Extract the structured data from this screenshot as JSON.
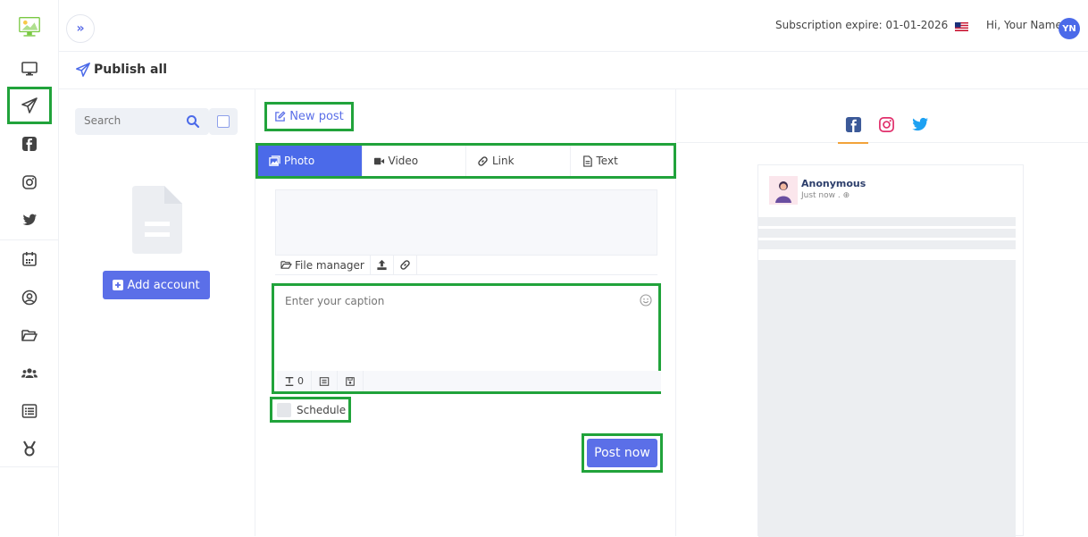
{
  "topbar": {
    "expand_icon": "double-chevron-right-icon",
    "subscription": "Subscription expire: 01-01-2026",
    "greeting": "Hi, Your Name",
    "avatar_initials": "YN"
  },
  "sidebar": {
    "items": [
      {
        "name": "dashboard-icon"
      },
      {
        "name": "paper-plane-icon",
        "active": true
      },
      {
        "name": "facebook-icon"
      },
      {
        "name": "instagram-icon"
      },
      {
        "name": "twitter-icon"
      },
      {
        "name": "calendar-icon"
      },
      {
        "name": "user-circle-icon"
      },
      {
        "name": "folder-icon"
      },
      {
        "name": "users-icon"
      },
      {
        "name": "list-icon"
      },
      {
        "name": "medal-icon"
      }
    ]
  },
  "header": {
    "title": "Publish all"
  },
  "accounts": {
    "search_placeholder": "Search",
    "add_account_label": "Add account"
  },
  "composer": {
    "new_post_label": "New post",
    "tabs": [
      {
        "label": "Photo",
        "active": true
      },
      {
        "label": "Video"
      },
      {
        "label": "Link"
      },
      {
        "label": "Text"
      }
    ],
    "media_tools": {
      "file_manager": "File manager"
    },
    "caption_placeholder": "Enter your caption",
    "char_count": "0",
    "schedule_label": "Schedule",
    "post_now_label": "Post now"
  },
  "preview": {
    "tabs": [
      "facebook",
      "instagram",
      "twitter"
    ],
    "author": "Anonymous",
    "time": "Just now ."
  },
  "colors": {
    "accent": "#4b6ae9",
    "button": "#5b6fe8",
    "highlight": "#21a33b",
    "facebook": "#3b5998",
    "instagram": "#e1306c",
    "twitter": "#1da1f2"
  }
}
